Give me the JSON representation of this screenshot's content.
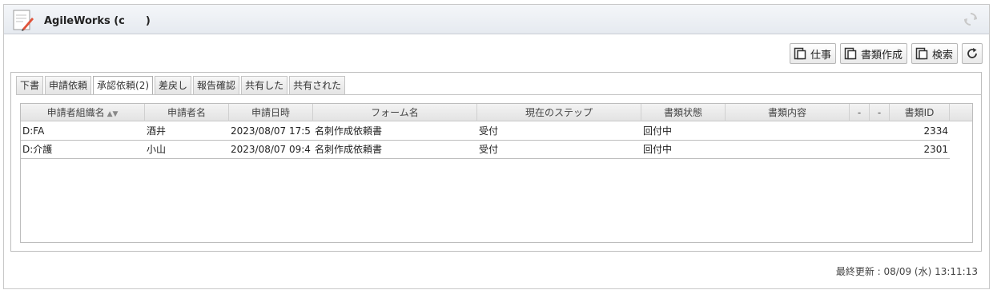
{
  "header": {
    "title": "AgileWorks (c　　)"
  },
  "toolbar": {
    "job_label": "仕事",
    "create_doc_label": "書類作成",
    "search_label": "検索"
  },
  "tabs": [
    {
      "label": "下書"
    },
    {
      "label": "申請依頼"
    },
    {
      "label": "承認依頼(2)"
    },
    {
      "label": "差戻し"
    },
    {
      "label": "報告確認"
    },
    {
      "label": "共有した"
    },
    {
      "label": "共有された"
    }
  ],
  "grid": {
    "columns": [
      "申請者組織名",
      "申請者名",
      "申請日時",
      "フォーム名",
      "現在のステップ",
      "書類状態",
      "書類内容",
      "-",
      "-",
      "書類ID"
    ],
    "rows": [
      {
        "org": "D:FA",
        "name": "酒井",
        "date": "2023/08/07 17:5",
        "form": "名刺作成依頼書",
        "step": "受付",
        "status": "回付中",
        "content": "",
        "d1": "",
        "d2": "",
        "id": "2334"
      },
      {
        "org": "D:介護",
        "name": "小山",
        "date": "2023/08/07 09:4",
        "form": "名刺作成依頼書",
        "step": "受付",
        "status": "回付中",
        "content": "",
        "d1": "",
        "d2": "",
        "id": "2301"
      }
    ]
  },
  "footer": {
    "last_updated": "最終更新 : 08/09 (水) 13:11:13"
  },
  "colors": {
    "header_bg": "#e6eaf0",
    "border": "#c8c8c8",
    "pencil": "#e0533a"
  },
  "icons": [
    "document-pencil-icon",
    "reload-icon",
    "window-icon",
    "refresh-icon",
    "sort-icon"
  ]
}
